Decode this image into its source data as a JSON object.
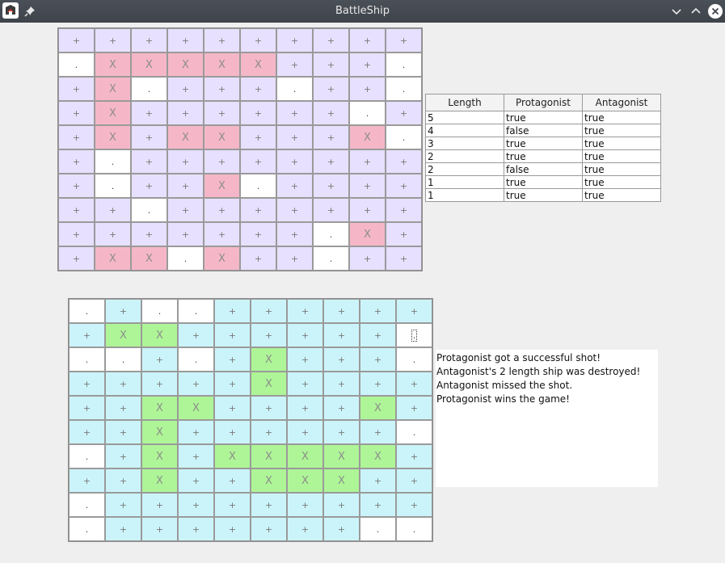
{
  "window": {
    "title": "BattleShip",
    "buttons": [
      "minimize",
      "maximize",
      "close"
    ]
  },
  "colors": {
    "titlebar": "#454a52",
    "top_water": "#e7e0ff",
    "top_hit": "#f5b7c8",
    "bottom_water": "#cbf4fa",
    "bottom_hit": "#aef597",
    "miss": "#ffffff",
    "log_bg": "#ffffff"
  },
  "symbols": {
    "water": "+",
    "hit": "X",
    "miss": "."
  },
  "top_board": [
    "++++++++++",
    ".XXXXX+++.",
    "+X.+++.++.",
    "+X++++++.+",
    "+X+XX+++X.",
    "+.++++++++",
    "+.++X.++++",
    "++.+++++++",
    "+++++++.X+",
    "+XX.X++.++"
  ],
  "bottom_board": [
    "+..++++++",
    "+XX++++++!",
    "..+.+X+++.",
    "++++X++++",
    "++XX++++X+",
    "++X++++++.",
    ".+X+XXXXX+",
    "++X++XXX++",
    ".+++++++++",
    ".+++++++.."
  ],
  "bottom_board_full": [
    ".+..++++++",
    "+XX++++++I",
    "..+.+X+++.",
    "+++++X++++",
    "++XX++++X+",
    "++X++++++.",
    ".+X+XXXXX+",
    "++X++XXX++",
    ".+++++++++",
    ".+++++++.."
  ],
  "ships_table": {
    "headers": [
      "Length",
      "Protagonist",
      "Antagonist"
    ],
    "rows": [
      [
        "5",
        "true",
        "true"
      ],
      [
        "4",
        "false",
        "true"
      ],
      [
        "3",
        "true",
        "true"
      ],
      [
        "2",
        "true",
        "true"
      ],
      [
        "2",
        "false",
        "true"
      ],
      [
        "1",
        "true",
        "true"
      ],
      [
        "1",
        "true",
        "true"
      ]
    ]
  },
  "log": [
    "Protagonist got a successful shot!",
    "Antagonist's 2 length ship was destroyed!",
    "Antagonist missed the shot.",
    "Protagonist wins the game!"
  ]
}
